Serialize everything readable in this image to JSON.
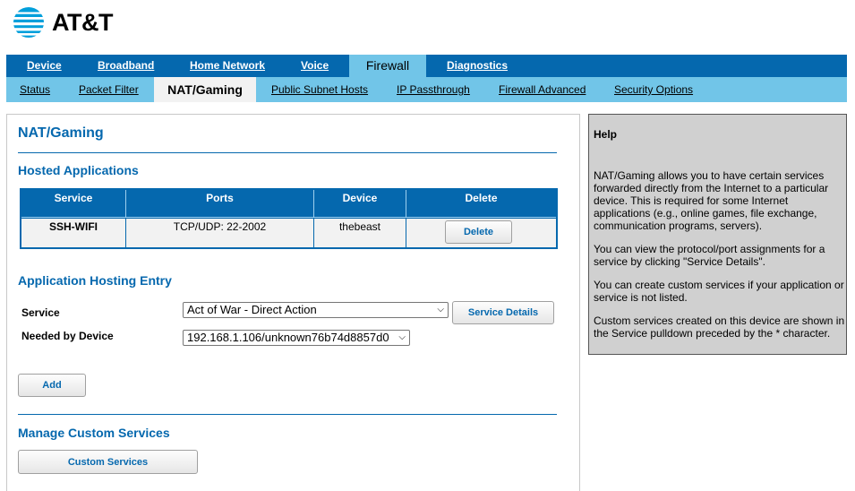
{
  "brand": {
    "name": "AT&T",
    "color": "#0568ae",
    "icon": "att-globe-logo"
  },
  "nav_primary": [
    {
      "label": "Device",
      "active": false
    },
    {
      "label": "Broadband",
      "active": false
    },
    {
      "label": "Home Network",
      "active": false
    },
    {
      "label": "Voice",
      "active": false
    },
    {
      "label": "Firewall",
      "active": true
    },
    {
      "label": "Diagnostics",
      "active": false
    }
  ],
  "nav_secondary": [
    {
      "label": "Status",
      "active": false
    },
    {
      "label": "Packet Filter",
      "active": false
    },
    {
      "label": "NAT/Gaming",
      "active": true
    },
    {
      "label": "Public Subnet Hosts",
      "active": false
    },
    {
      "label": "IP Passthrough",
      "active": false
    },
    {
      "label": "Firewall Advanced",
      "active": false
    },
    {
      "label": "Security Options",
      "active": false
    }
  ],
  "main": {
    "title": "NAT/Gaming",
    "hosted_heading": "Hosted Applications",
    "table": {
      "headers": [
        "Service",
        "Ports",
        "Device",
        "Delete"
      ],
      "rows": [
        {
          "service": "SSH-WIFI",
          "ports": "TCP/UDP: 22-2002",
          "device": "thebeast",
          "delete_label": "Delete"
        }
      ]
    },
    "entry_heading": "Application Hosting Entry",
    "service_label": "Service",
    "service_value": "Act of War - Direct Action",
    "service_details_label": "Service Details",
    "device_label": "Needed by Device",
    "device_value": "192.168.1.106/unknown76b74d8857d0",
    "add_label": "Add",
    "custom_heading": "Manage Custom Services",
    "custom_label": "Custom Services"
  },
  "help": {
    "title": "Help",
    "paragraphs": [
      "NAT/Gaming allows you to have certain services forwarded directly from the Internet to a particular device. This is required for some Internet applications (e.g., online games, file exchange, communication programs, servers).",
      "You can view the protocol/port assignments for a service by clicking \"Service Details\".",
      "You can create custom services if your application or service is not listed.",
      "Custom services created on this device are shown in the Service pulldown preceded by the * character."
    ]
  }
}
